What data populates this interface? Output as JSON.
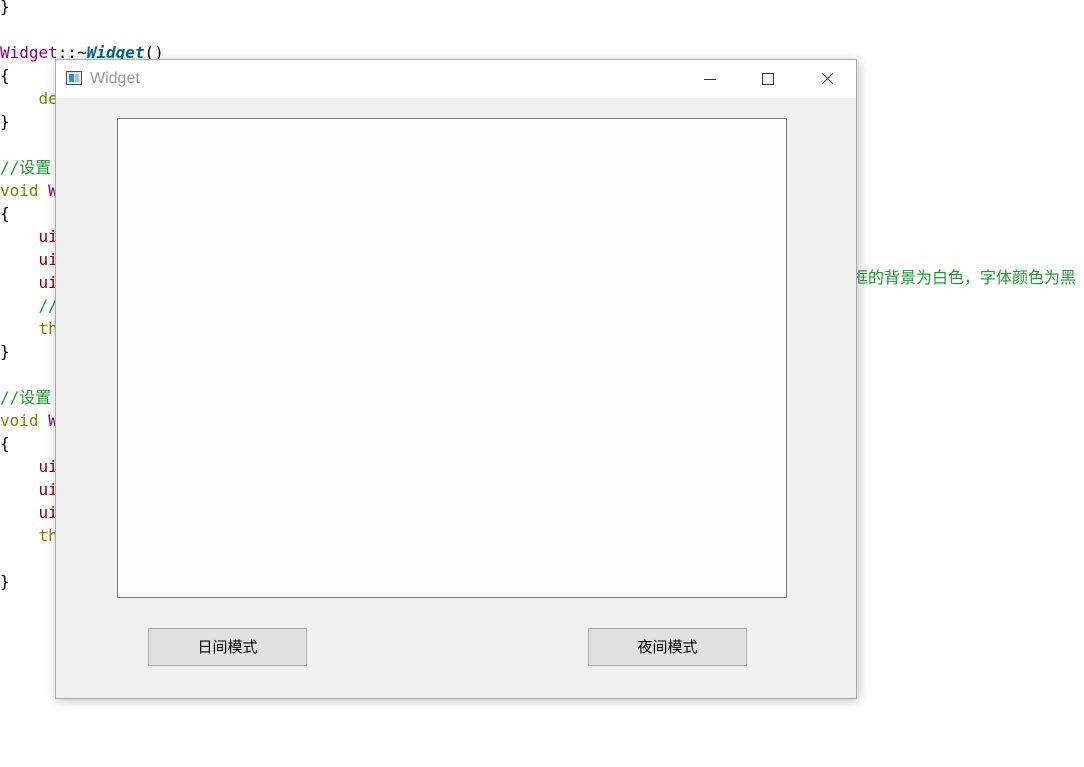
{
  "editor": {
    "lines": [
      {
        "text": "}",
        "style": "brace"
      },
      {
        "text": "",
        "style": "brace"
      },
      {
        "text": "Widget::~Widget()",
        "style": "destructor"
      },
      {
        "text": "{",
        "style": "brace"
      },
      {
        "text": "    de",
        "style": "keyword"
      },
      {
        "text": "}",
        "style": "brace"
      },
      {
        "text": "",
        "style": "brace"
      },
      {
        "text": "//设置",
        "style": "comment"
      },
      {
        "text": "void W",
        "style": "void"
      },
      {
        "text": "{",
        "style": "brace"
      },
      {
        "text": "    ui",
        "style": "member"
      },
      {
        "text": "    ui",
        "style": "member"
      },
      {
        "text": "    ui",
        "style": "member"
      },
      {
        "text": "    //",
        "style": "comment"
      },
      {
        "text": "    th",
        "style": "keyword"
      },
      {
        "text": "}",
        "style": "brace"
      },
      {
        "text": "",
        "style": "brace"
      },
      {
        "text": "//设置",
        "style": "comment"
      },
      {
        "text": "void W",
        "style": "void"
      },
      {
        "text": "{",
        "style": "brace"
      },
      {
        "text": "    ui",
        "style": "member"
      },
      {
        "text": "    ui",
        "style": "member"
      },
      {
        "text": "    ui",
        "style": "member"
      },
      {
        "text": "    th",
        "style": "keyword"
      },
      {
        "text": "",
        "style": "brace"
      },
      {
        "text": "}",
        "style": "brace"
      }
    ],
    "overflow_comment": "框的背景为白色，字体颜色为黑"
  },
  "window": {
    "title": "Widget",
    "app_icon": "qt-window-icon",
    "controls": {
      "minimize": "minimize-icon",
      "maximize": "maximize-icon",
      "close": "close-icon"
    },
    "text_edit": {
      "value": ""
    },
    "buttons": {
      "day_mode": "日间模式",
      "night_mode": "夜间模式"
    }
  },
  "colors": {
    "comment": "#1e9a2f",
    "keyword": "#808000",
    "class": "#800080",
    "function": "#00677c",
    "member": "#800000",
    "window_bg": "#f0f0f0",
    "button_bg": "#e1e1e1"
  }
}
